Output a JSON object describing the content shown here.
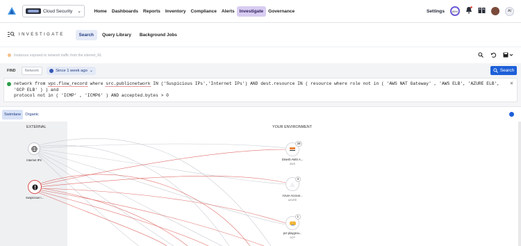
{
  "topbar": {
    "product": "Cloud Security",
    "nav": [
      "Home",
      "Dashboards",
      "Reports",
      "Inventory",
      "Compliance",
      "Alerts",
      "Investigate",
      "Governance"
    ],
    "active_nav": "Investigate",
    "settings": "Settings",
    "score": "85%",
    "ai_label": "AI"
  },
  "subbar": {
    "title": "INVESTIGATE",
    "tabs": [
      "Search",
      "Query Library",
      "Background Jobs"
    ],
    "active_tab": "Search"
  },
  "searchrow": {
    "placeholder": "Instances exposed to network traffic from the internet_RL"
  },
  "findrow": {
    "find": "FIND",
    "network": "Network",
    "time": "Since 1 week ago",
    "search_button": "Search"
  },
  "query": {
    "p1": "network from ",
    "u1": "vpc.flow_record",
    "p2": " where ",
    "u2": "src.publicnetwork",
    "p3": " IN ('Suspicious IPs','Internet IPs') AND dest.resource IN ( resource where role not in ( 'AWS NAT Gateway' , 'AWS ELB', 'AZURE ELB', 'GCP ELB' ) ) and",
    "line2": "protocol not in ( 'ICMP' , 'ICMP6' ) AND accepted.bytes > 0"
  },
  "view": {
    "tabs": [
      "Swimlane",
      "Organic"
    ],
    "active": "Swimlane"
  },
  "graph": {
    "external_heading": "EXTERNAL",
    "env_heading": "YOUR ENVIRONMENT",
    "sources": [
      {
        "label": "Internet IPs",
        "icon": "globe-icon"
      },
      {
        "label": "Suspicious I...",
        "icon": "alert-icon"
      }
    ],
    "targets": [
      {
        "label": "Dinesh AWS A...",
        "cloud": "AWS",
        "count": "28"
      },
      {
        "label": "Azure Accoun...",
        "cloud": "AZURE",
        "count": "3"
      },
      {
        "label": "pcr-playgrou...",
        "cloud": "GCP",
        "count": "1"
      }
    ],
    "colors": {
      "accent": "#1d5fd8",
      "edge_red": "#d9534f",
      "edge_grey": "#c9ccd2",
      "active_nav_bg": "#d9cdf2"
    }
  }
}
